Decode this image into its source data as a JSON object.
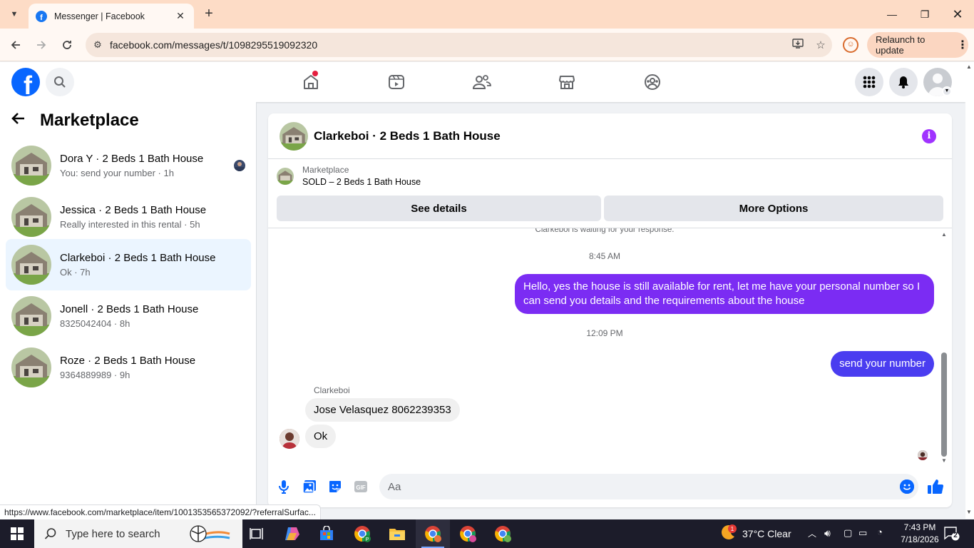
{
  "browser": {
    "tab_title": "Messenger | Facebook",
    "url": "facebook.com/messages/t/1098295519092320",
    "relaunch_label": "Relaunch to update",
    "status_url": "https://www.facebook.com/marketplace/item/1001353565372092/?referralSurfac..."
  },
  "header": {
    "logo_text": "f",
    "icons": [
      "search-icon",
      "home-icon",
      "video-icon",
      "friends-icon",
      "marketplace-icon",
      "groups-icon",
      "menu-grid-icon",
      "bell-icon",
      "avatar"
    ]
  },
  "left_panel": {
    "title": "Marketplace",
    "conversations": [
      {
        "name": "Dora Y · 2 Beds 1 Bath House",
        "subtitle": "You: send your number · 1h"
      },
      {
        "name": "Jessica · 2 Beds 1 Bath House",
        "subtitle": "Really interested in this rental · 5h"
      },
      {
        "name": "Clarkeboi · 2 Beds 1 Bath House",
        "subtitle": "Ok · 7h"
      },
      {
        "name": "Jonell · 2 Beds 1 Bath House",
        "subtitle": "8325042404 · 8h"
      },
      {
        "name": "Roze · 2 Beds 1 Bath House",
        "subtitle": "9364889989 · 9h"
      }
    ]
  },
  "chat": {
    "title": "Clarkeboi · 2 Beds 1 Bath House",
    "marketplace_label": "Marketplace",
    "listing": "SOLD – 2 Beds 1 Bath House",
    "see_details": "See details",
    "more_options": "More Options",
    "waiting_note": "Clarkeboi is waiting for your response.",
    "time1": "8:45 AM",
    "msg1": "Hello, yes the house is still available for rent, let me have your personal number so I can send you details and the requirements about the house",
    "time2": "12:09 PM",
    "msg2": "send your number",
    "sender": "Clarkeboi",
    "msg3": "Jose Velasquez 8062239353",
    "msg4": "Ok",
    "composer_placeholder": "Aa",
    "gif_label": "GIF"
  },
  "taskbar": {
    "search_placeholder": "Type here to search",
    "weather": "37°C  Clear",
    "weather_badge": "1",
    "time": "7:43 PM",
    "date": "7/18/2026",
    "notif_count": "2"
  },
  "colors": {
    "fb_blue": "#0866ff",
    "outgoing_purple": "#7b2cf3",
    "outgoing_blue": "#4a3df0",
    "active_conv": "#ebf5ff",
    "chrome_tabbar": "#fddcc6"
  }
}
